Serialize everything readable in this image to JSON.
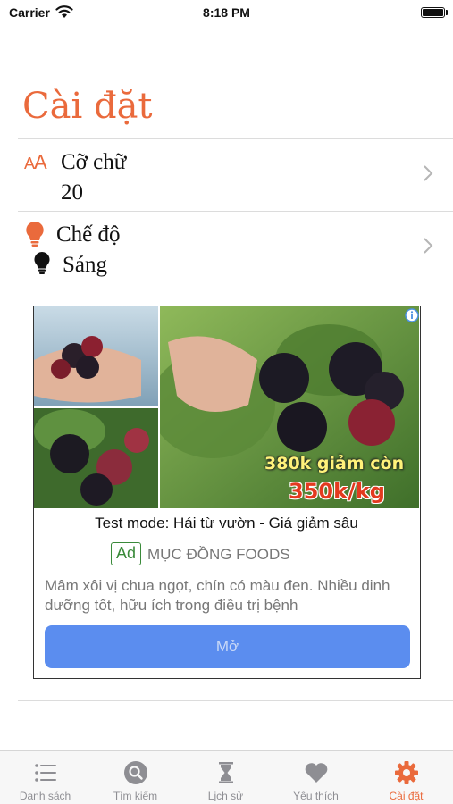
{
  "status_bar": {
    "carrier": "Carrier",
    "time": "8:18 PM"
  },
  "page_title": "Cài đặt",
  "settings": {
    "font_size": {
      "icon": "font-size-icon",
      "icon_text_small": "A",
      "icon_text_big": "A",
      "label": "Cỡ chữ",
      "value": "20"
    },
    "mode": {
      "icon": "lightbulb-icon",
      "label": "Chế độ",
      "value_icon": "lightbulb-dark-icon",
      "value": "Sáng"
    }
  },
  "ad": {
    "price_old": "380k giảm còn",
    "price_new": "350k/kg",
    "headline": "Test mode: Hái từ vườn - Giá giảm sâu",
    "badge": "Ad",
    "advertiser": "MỤC ĐỒNG FOODS",
    "body": "Mâm xôi vị chua ngọt, chín có màu đen. Nhiều dinh dưỡng tốt, hữu ích trong điều trị bệnh",
    "cta": "Mở"
  },
  "tabs": [
    {
      "label": "Danh sách",
      "icon": "list-icon",
      "active": false
    },
    {
      "label": "Tìm kiếm",
      "icon": "search-icon",
      "active": false
    },
    {
      "label": "Lịch sử",
      "icon": "hourglass-icon",
      "active": false
    },
    {
      "label": "Yêu thích",
      "icon": "heart-icon",
      "active": false
    },
    {
      "label": "Cài đặt",
      "icon": "gear-icon",
      "active": true
    }
  ],
  "colors": {
    "accent": "#ea6a3c",
    "tab_inactive": "#8e8e93",
    "ad_button": "#5b8def"
  }
}
